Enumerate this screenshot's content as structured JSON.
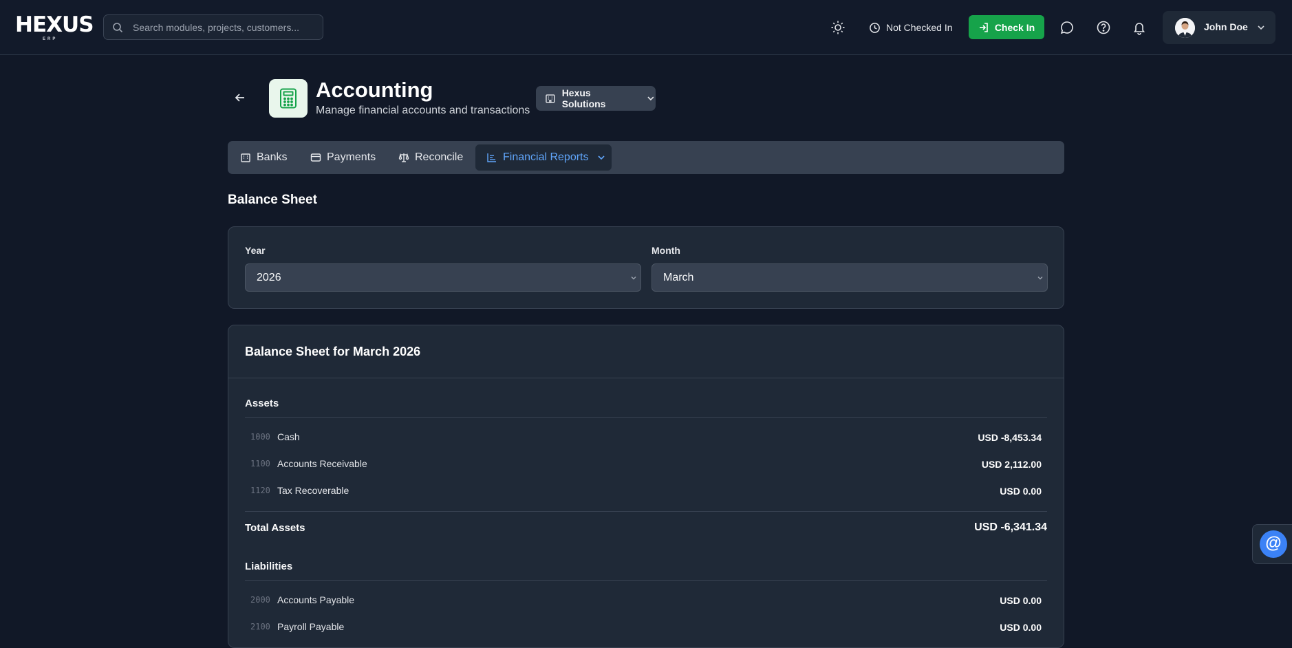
{
  "topbar": {
    "logo_text": "HEXUS",
    "logo_sub": "ERP",
    "search_placeholder": "Search modules, projects, customers...",
    "status_text": "Not Checked In",
    "checkin_label": "Check In",
    "user_name": "John Doe"
  },
  "header": {
    "title": "Accounting",
    "subtitle": "Manage financial accounts and transactions",
    "company": "Hexus Solutions"
  },
  "tabs": [
    {
      "label": "Banks",
      "icon": "bank-icon"
    },
    {
      "label": "Payments",
      "icon": "card-icon"
    },
    {
      "label": "Reconcile",
      "icon": "scale-icon"
    },
    {
      "label": "Financial Reports",
      "icon": "chart-icon",
      "active": true
    }
  ],
  "section_title": "Balance Sheet",
  "filters": {
    "year_label": "Year",
    "year_value": "2026",
    "month_label": "Month",
    "month_value": "March"
  },
  "report": {
    "title": "Balance Sheet for March 2026",
    "assets": {
      "title": "Assets",
      "rows": [
        {
          "code": "1000",
          "name": "Cash",
          "amount": "USD -8,453.34"
        },
        {
          "code": "1100",
          "name": "Accounts Receivable",
          "amount": "USD 2,112.00"
        },
        {
          "code": "1120",
          "name": "Tax Recoverable",
          "amount": "USD 0.00"
        }
      ],
      "total_label": "Total Assets",
      "total_amount": "USD -6,341.34"
    },
    "liabilities": {
      "title": "Liabilities",
      "rows": [
        {
          "code": "2000",
          "name": "Accounts Payable",
          "amount": "USD 0.00"
        },
        {
          "code": "2100",
          "name": "Payroll Payable",
          "amount": "USD 0.00"
        }
      ]
    }
  },
  "floating": {
    "label": "@"
  },
  "colors": {
    "background": "#111827",
    "card": "#1f2937",
    "accent": "#60a5fa",
    "checkin": "#16a34a",
    "app_icon": "#16a34a"
  }
}
